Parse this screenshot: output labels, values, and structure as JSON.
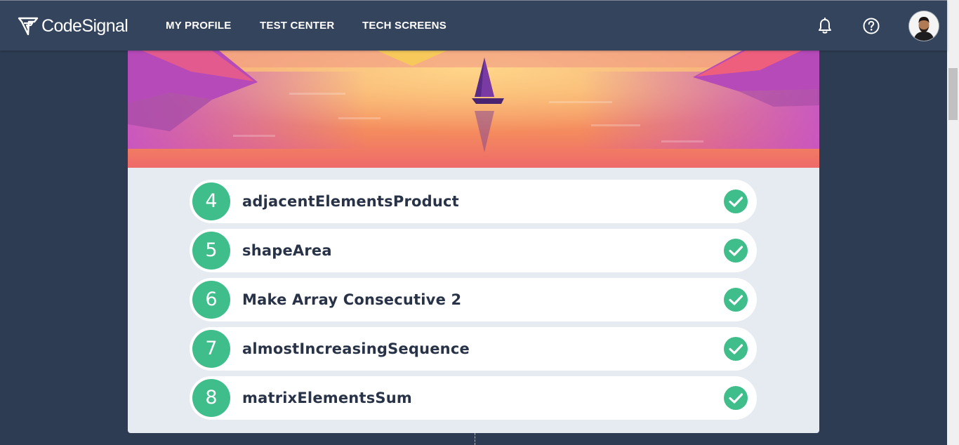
{
  "app": {
    "logo_text": "CodeSignal"
  },
  "nav": {
    "items": [
      {
        "label": "MY PROFILE"
      },
      {
        "label": "TEST CENTER"
      },
      {
        "label": "TECH SCREENS"
      }
    ],
    "icons": [
      "bell-icon",
      "help-icon",
      "avatar"
    ]
  },
  "colors": {
    "topbar": "#34445c",
    "background": "#2d3c52",
    "card": "#e6ebf2",
    "accent_green": "#3fbd8b",
    "task_text": "#283347"
  },
  "tasks": [
    {
      "number": "4",
      "title": "adjacentElementsProduct",
      "status": "completed"
    },
    {
      "number": "5",
      "title": "shapeArea",
      "status": "completed"
    },
    {
      "number": "6",
      "title": "Make Array Consecutive 2",
      "status": "completed"
    },
    {
      "number": "7",
      "title": "almostIncreasingSequence",
      "status": "completed"
    },
    {
      "number": "8",
      "title": "matrixElementsSum",
      "status": "completed"
    }
  ]
}
